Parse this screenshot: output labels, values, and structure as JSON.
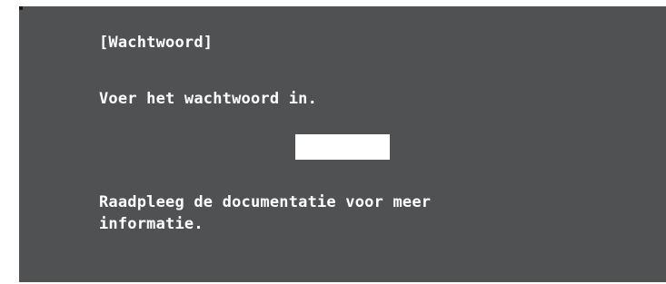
{
  "dialog": {
    "title": "[Wachtwoord]",
    "prompt": "Voer het wachtwoord in.",
    "password_value": "",
    "info": "Raadpleeg de documentatie voor meer informatie."
  },
  "colors": {
    "dialog_background": "#505153",
    "text": "#ffffff",
    "input_background": "#ffffff"
  }
}
